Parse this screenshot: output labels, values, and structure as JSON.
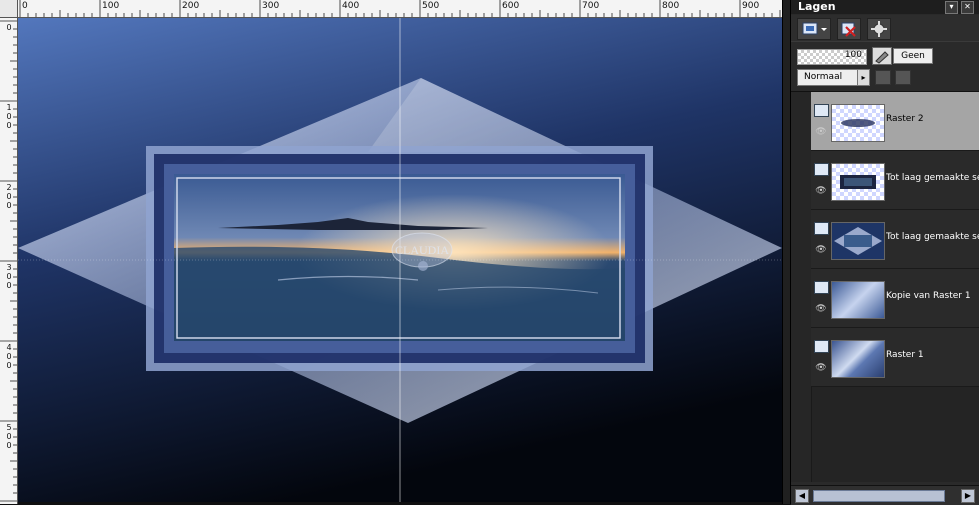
{
  "rulers": {
    "top_labels": [
      "0",
      "100",
      "200",
      "300",
      "400",
      "500",
      "600",
      "700",
      "800",
      "900"
    ],
    "left_labels": [
      "0",
      "1 0 0",
      "2 0 0",
      "3 0 0",
      "4 0 0",
      "5 0 0"
    ]
  },
  "canvas": {
    "watermark_text": "CLAUDIA",
    "colors": {
      "background_top": "#4a6fb3",
      "background_bottom": "#04070f",
      "diamond": "#c9d4ee",
      "frame": "#7f94c4",
      "inner_border": "#d0d8ea"
    }
  },
  "layers_panel": {
    "title": "Lagen",
    "header_buttons": [
      "pin-icon",
      "close-icon"
    ],
    "toolbar_icons": [
      "new-layer-icon",
      "delete-layer-icon",
      "properties-icon"
    ],
    "opacity": "100",
    "mask_label": "Geen",
    "blend_mode": "Normaal",
    "layers": [
      {
        "name": "Raster 2",
        "selected": true,
        "icon": "raster-layer-icon"
      },
      {
        "name": "Tot laag gemaakte selectie",
        "selected": false,
        "icon": "raster-layer-icon"
      },
      {
        "name": "Tot laag gemaakte selectie",
        "selected": false,
        "icon": "raster-layer-icon"
      },
      {
        "name": "Kopie van Raster 1",
        "selected": false,
        "icon": "raster-layer-icon"
      },
      {
        "name": "Raster 1",
        "selected": false,
        "icon": "raster-layer-icon"
      }
    ]
  }
}
